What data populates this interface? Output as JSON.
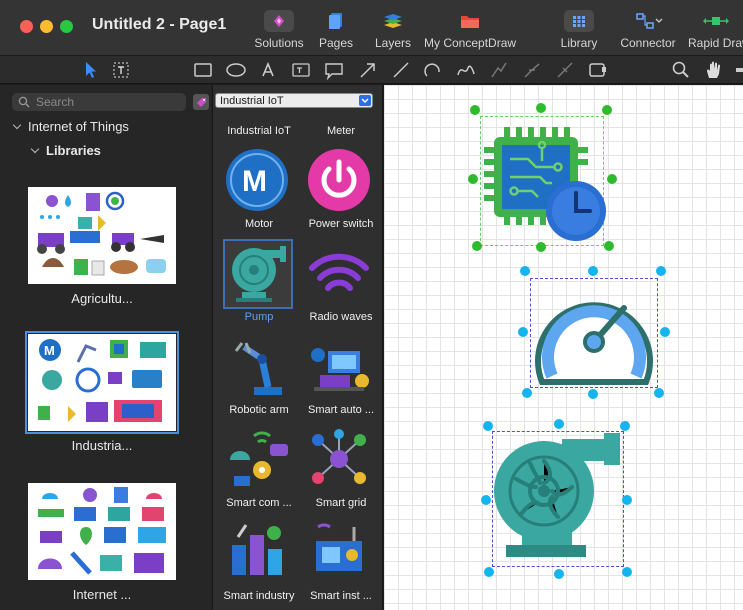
{
  "window": {
    "title": "Untitled 2 - Page1"
  },
  "toolbar": {
    "items": [
      {
        "label": "Solutions",
        "icon": "solutions-icon"
      },
      {
        "label": "Pages",
        "icon": "pages-icon"
      },
      {
        "label": "Layers",
        "icon": "layers-icon"
      },
      {
        "label": "My ConceptDraw",
        "icon": "folder-icon"
      },
      {
        "label": "Library",
        "icon": "library-grid-icon"
      },
      {
        "label": "Connector",
        "icon": "connector-icon"
      },
      {
        "label": "Rapid Draw",
        "icon": "rapid-draw-icon"
      }
    ]
  },
  "sidebar": {
    "search_placeholder": "Search",
    "tree": {
      "root": "Internet of Things",
      "child": "Libraries"
    },
    "libraries": [
      {
        "label": "Agricultu..."
      },
      {
        "label": "Industria..."
      },
      {
        "label": "Internet ..."
      }
    ]
  },
  "library_panel": {
    "selected_library": "Industrial IoT",
    "items": [
      {
        "label": "Industrial IoT"
      },
      {
        "label": "Meter"
      },
      {
        "label": "Motor"
      },
      {
        "label": "Power switch"
      },
      {
        "label": "Pump"
      },
      {
        "label": "Radio waves"
      },
      {
        "label": "Robotic arm"
      },
      {
        "label": "Smart auto ..."
      },
      {
        "label": "Smart com ..."
      },
      {
        "label": "Smart grid"
      },
      {
        "label": "Smart industry"
      },
      {
        "label": "Smart inst ..."
      }
    ]
  },
  "colors": {
    "handle_green": "#2dbb2d",
    "handle_cyan": "#14b4ee",
    "selection_accent": "#4a90e2",
    "teal": "#3aa7a0",
    "motor_blue": "#1f6fc4",
    "power_pink": "#e43aa8",
    "wave_purple": "#8a3dd6"
  }
}
